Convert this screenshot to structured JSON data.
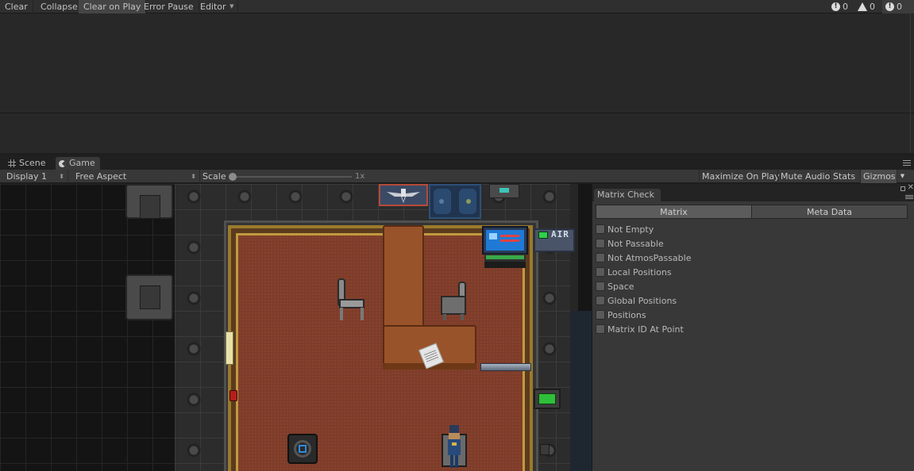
{
  "console_toolbar": {
    "clear_label": "Clear",
    "collapse_label": "Collapse",
    "clear_on_play_label": "Clear on Play",
    "error_pause_label": "Error Pause",
    "editor_label": "Editor",
    "error_count": "0",
    "warning_count": "0",
    "info_count": "0"
  },
  "tabs": {
    "scene_label": "Scene",
    "game_label": "Game"
  },
  "game_toolbar": {
    "display_label": "Display 1",
    "aspect_label": "Free Aspect",
    "scale_label": "Scale",
    "scale_value": "1x",
    "scale_level": 0,
    "maximize_on_play_label": "Maximize On Play",
    "mute_audio_label": "Mute Audio",
    "stats_label": "Stats",
    "gizmos_label": "Gizmos"
  },
  "game_view": {
    "air_sign_text": "AIR"
  },
  "matrix_check": {
    "title": "Matrix Check",
    "segments": [
      "Matrix",
      "Meta Data"
    ],
    "selected_segment": "Matrix",
    "toggles": [
      {
        "label": "Not Empty",
        "checked": false
      },
      {
        "label": "Not Passable",
        "checked": false
      },
      {
        "label": "Not AtmosPassable",
        "checked": false
      },
      {
        "label": "Local Positions",
        "checked": false
      },
      {
        "label": "Space",
        "checked": false
      },
      {
        "label": "Global Positions",
        "checked": false
      },
      {
        "label": "Positions",
        "checked": false
      },
      {
        "label": "Matrix ID At Point",
        "checked": false
      }
    ]
  },
  "colors": {
    "carpet": "#7e3c2a",
    "desk": "#99532a",
    "gold_trim": "#c09a3e",
    "status_light": "#2ecf4a",
    "vent_core": "#2f8bd8"
  }
}
